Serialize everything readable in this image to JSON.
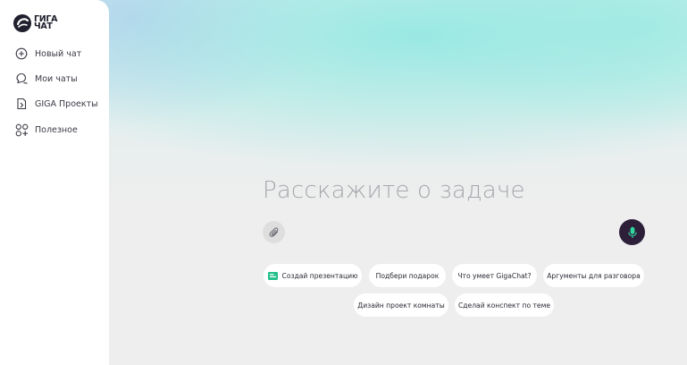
{
  "logo": {
    "line1": "ГИГА",
    "line2": "ЧАТ"
  },
  "sidebar": {
    "items": [
      {
        "label": "Новый чат",
        "icon": "new-chat-icon"
      },
      {
        "label": "Мои чаты",
        "icon": "chats-icon"
      },
      {
        "label": "GIGA Проекты",
        "icon": "projects-icon"
      },
      {
        "label": "Полезное",
        "icon": "apps-icon"
      }
    ]
  },
  "main": {
    "placeholder": "Расскажите о задаче",
    "attach_icon": "paperclip-icon",
    "mic_icon": "microphone-icon"
  },
  "suggestions": [
    {
      "label": "Создай презентацию",
      "icon": "presentation-icon"
    },
    {
      "label": "Подбери подарок"
    },
    {
      "label": "Что умеет GigaChat?"
    },
    {
      "label": "Аргументы для разговора"
    },
    {
      "label": "Дизайн проект комнаты"
    },
    {
      "label": "Сделай конспект по теме"
    }
  ],
  "colors": {
    "accent_dark": "#2d1f3a",
    "mic_glyph": "#2fd6a0",
    "presentation_icon": "#21c08b"
  }
}
